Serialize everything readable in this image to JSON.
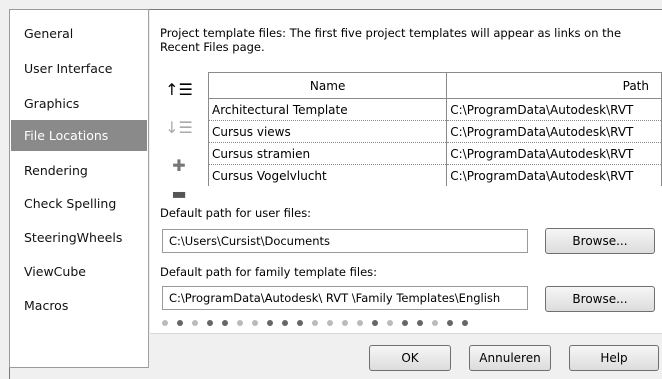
{
  "sidebar": {
    "items": [
      {
        "label": "General"
      },
      {
        "label": "User Interface"
      },
      {
        "label": "Graphics"
      },
      {
        "label": "File Locations"
      },
      {
        "label": "Rendering"
      },
      {
        "label": "Check Spelling"
      },
      {
        "label": "SteeringWheels"
      },
      {
        "label": "ViewCube"
      },
      {
        "label": "Macros"
      }
    ],
    "selected": "File Locations"
  },
  "templates": {
    "intro": "Project template files:  The first five project templates will appear as links on the Recent Files page.",
    "columns": {
      "name": "Name",
      "path": "Path"
    },
    "rows": [
      {
        "name": "Architectural Template",
        "path": "C:\\ProgramData\\Autodesk\\RVT"
      },
      {
        "name": "Cursus views",
        "path": "C:\\ProgramData\\Autodesk\\RVT"
      },
      {
        "name": "Cursus stramien",
        "path": "C:\\ProgramData\\Autodesk\\RVT"
      },
      {
        "name": "Cursus Vogelvlucht",
        "path": "C:\\ProgramData\\Autodesk\\RVT"
      }
    ],
    "tools": [
      {
        "icon": "move-up-icon",
        "glyph": "↑☰"
      },
      {
        "icon": "move-down-icon",
        "glyph": "↓☰"
      },
      {
        "icon": "add-icon",
        "glyph": "✚"
      },
      {
        "icon": "remove-icon",
        "glyph": "▬"
      }
    ]
  },
  "user_files": {
    "label": "Default path for user files:",
    "value": "C:\\Users\\Cursist\\Documents",
    "browse": "Browse..."
  },
  "family_templates": {
    "label": "Default path for family template files:",
    "value": "C:\\ProgramData\\Autodesk\\ RVT  \\Family Templates\\English",
    "browse": "Browse..."
  },
  "footer": {
    "ok": "OK",
    "cancel": "Annuleren",
    "help": "Help"
  }
}
